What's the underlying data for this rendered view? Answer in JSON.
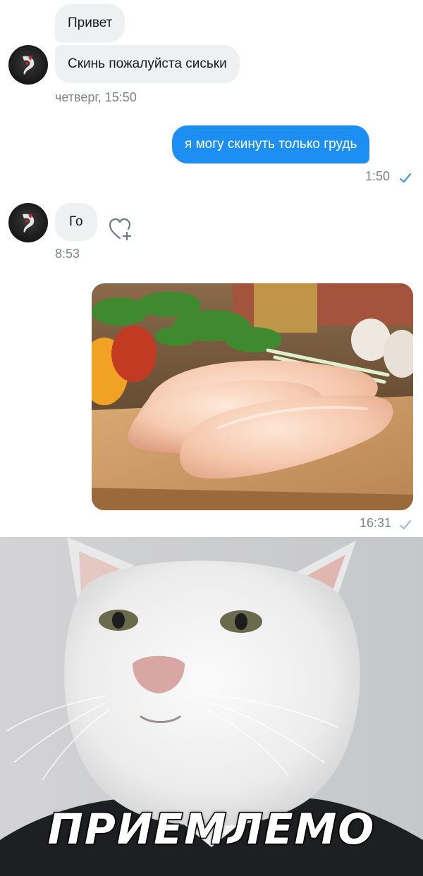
{
  "messages": {
    "m1_text": "Привет",
    "m2_text": "Скинь пожалуйста сиськи",
    "m2_time": "четверг, 15:50",
    "m3_text": "я могу скинуть только грудь",
    "m3_time": "1:50",
    "m4_text": "Го",
    "m4_time": "8:53",
    "m5_time": "16:31"
  },
  "meme": {
    "caption": "ПРИЕМЛЕМО"
  },
  "colors": {
    "outgoing_bubble": "#1d8ff2",
    "incoming_bubble": "#eef0f2",
    "timestamp": "#7c8287",
    "read_check": "#2a8ee8"
  },
  "icons": {
    "reaction": "heart-plus-icon",
    "read": "checkmark-icon"
  }
}
